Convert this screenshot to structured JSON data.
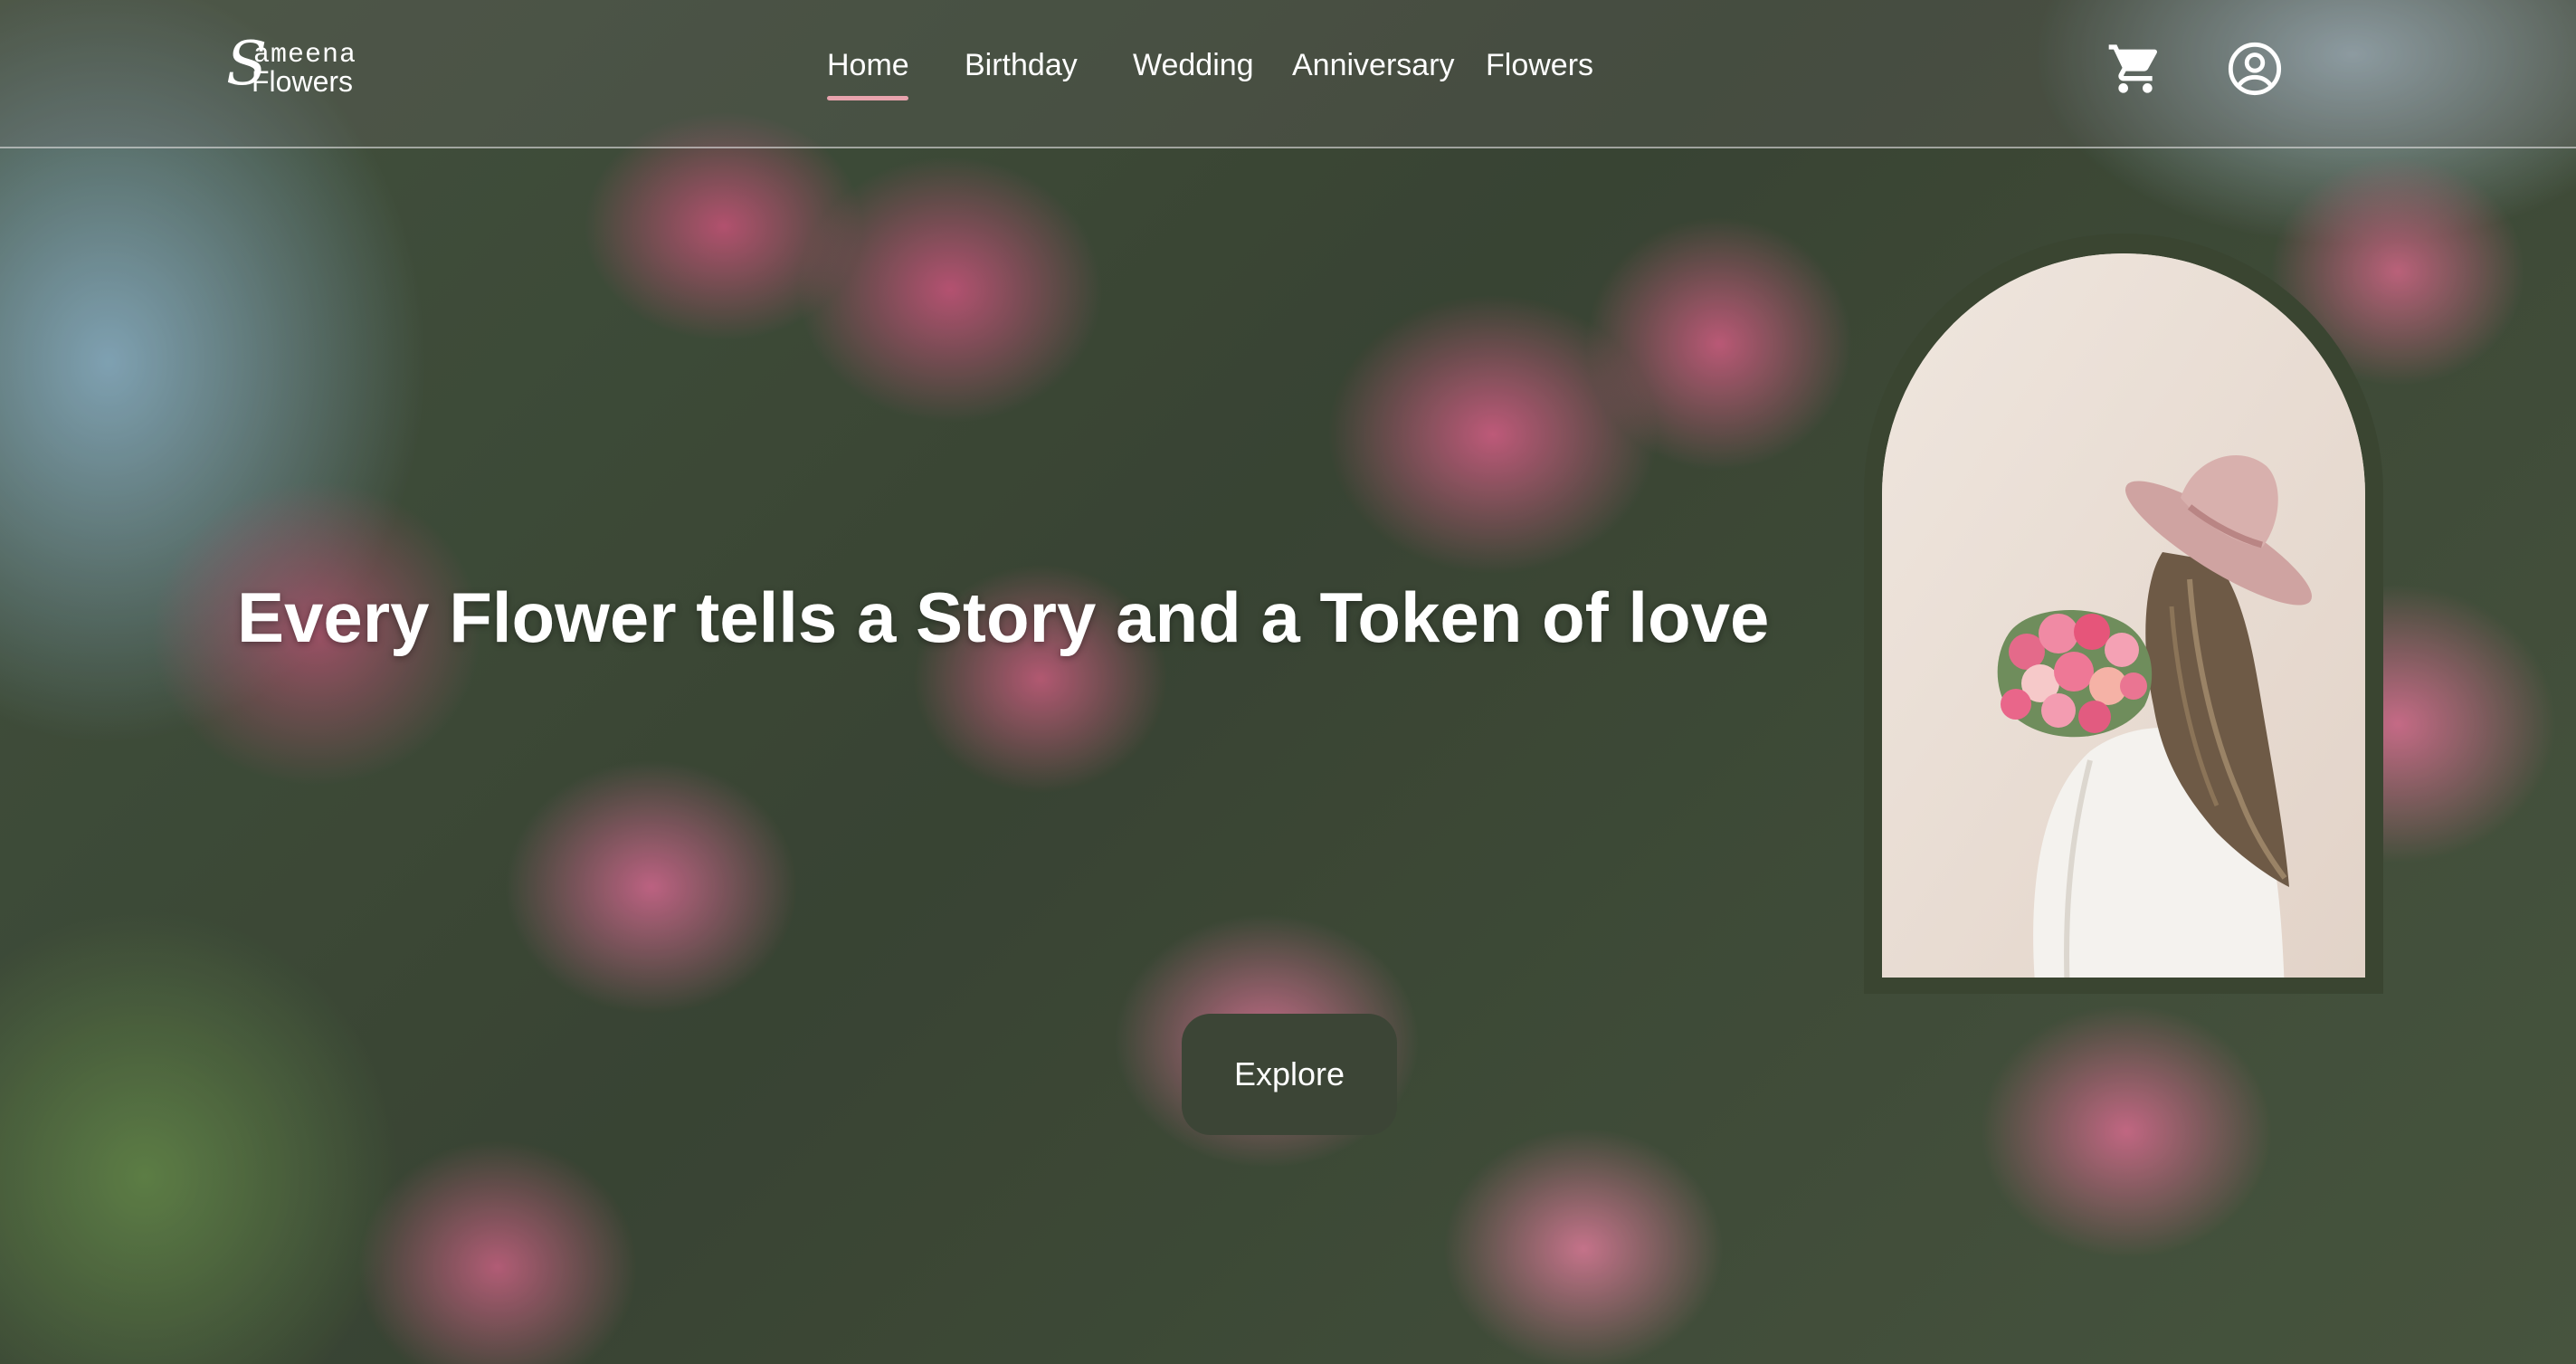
{
  "brand": {
    "logo_letter": "S",
    "logo_line1": "ameena",
    "logo_line2": "Flowers"
  },
  "nav": {
    "items": [
      {
        "label": "Home",
        "active": true
      },
      {
        "label": "Birthday",
        "active": false
      },
      {
        "label": "Wedding",
        "active": false
      },
      {
        "label": "Anniversary",
        "active": false
      },
      {
        "label": "Flowers",
        "active": false
      }
    ],
    "icons": [
      "cart-icon",
      "user-account-icon"
    ]
  },
  "hero": {
    "headline": "Every Flower tells a Story and a Token of love",
    "cta_label": "Explore"
  },
  "colors": {
    "frame": "#3a4531",
    "button": "#3c4536",
    "active_underline": "#e8a3ad",
    "text": "#ffffff"
  }
}
